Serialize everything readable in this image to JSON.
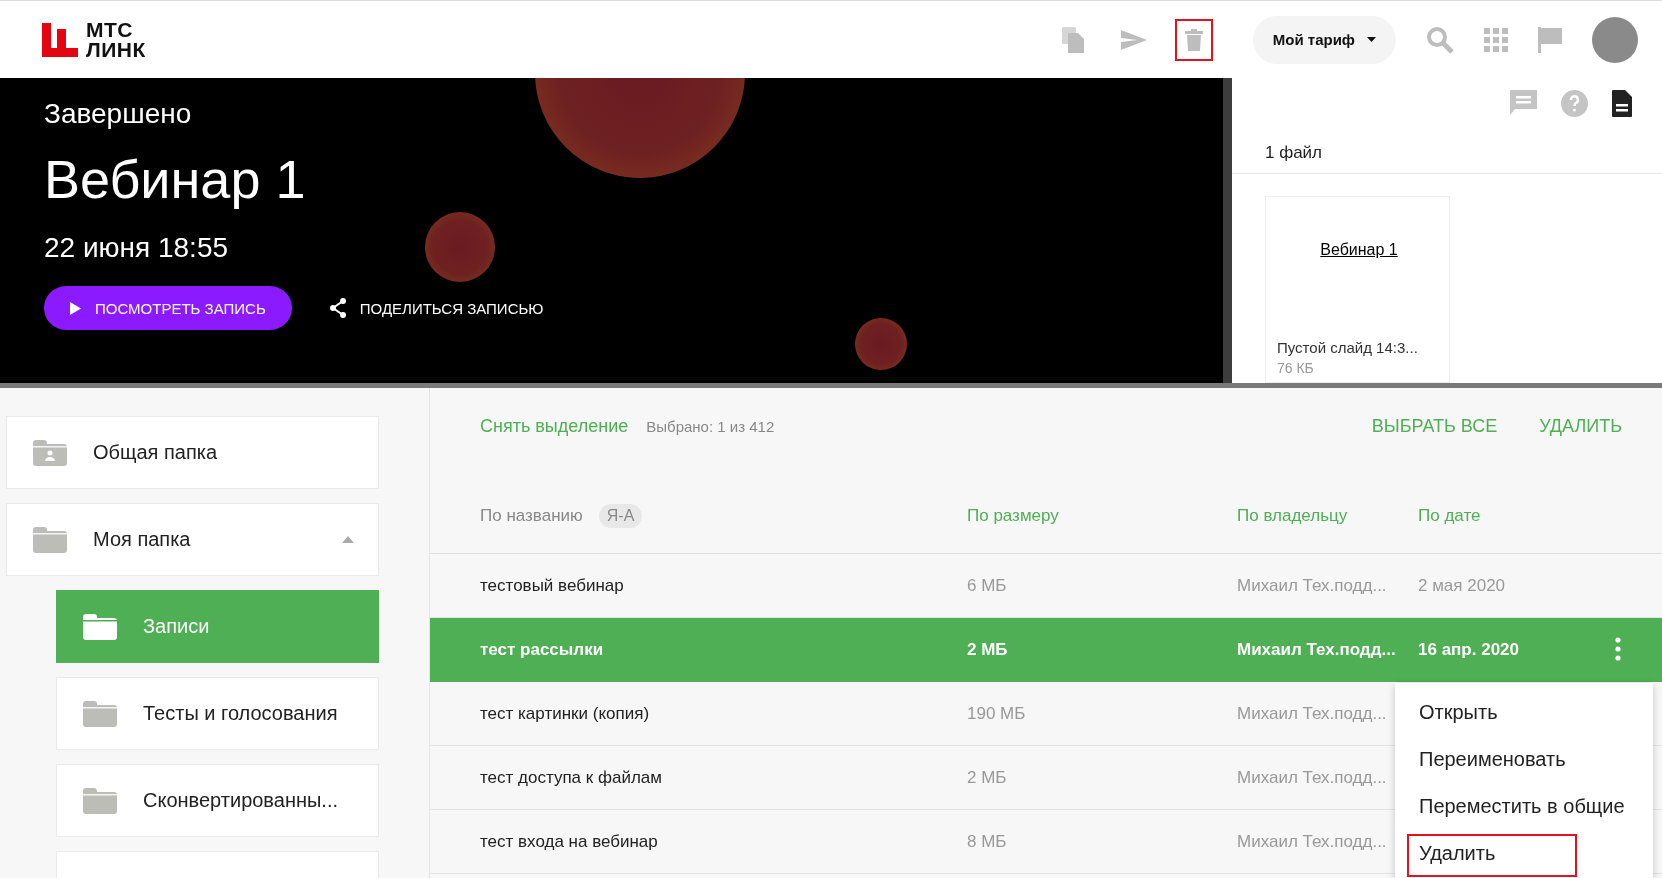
{
  "header": {
    "logo": {
      "line_1": "МТС",
      "line_2": "ЛИНК"
    },
    "toolbar_icons": [
      {
        "kind": "copy",
        "highlighted": false
      },
      {
        "kind": "send",
        "highlighted": false
      },
      {
        "kind": "trash",
        "highlighted": true
      }
    ],
    "plan_button": "Мой тариф"
  },
  "banner": {
    "status": "Завершено",
    "title": "Вебинар 1",
    "date": "22 июня 18:55",
    "watch_button": "ПОСМОТРЕТЬ ЗАПИСЬ",
    "share_button": "ПОДЕЛИТЬСЯ ЗАПИСЬЮ"
  },
  "files_panel": {
    "count": "1 файл",
    "files": [
      {
        "preview_title": "Вебинар 1",
        "name": "Пустой слайд 14:3...",
        "size": "76 КБ"
      }
    ]
  },
  "sidebar": {
    "items": [
      {
        "label": "Общая папка",
        "kind": "shared",
        "selected": false
      },
      {
        "label": "Моя папка",
        "kind": "folder",
        "selected": false,
        "expanded": true,
        "children": [
          {
            "label": "Записи",
            "kind": "folder",
            "selected": true
          },
          {
            "label": "Тесты и голосования",
            "kind": "folder",
            "selected": false
          },
          {
            "label": "Сконвертированны...",
            "kind": "folder",
            "selected": false
          }
        ]
      }
    ]
  },
  "selection_bar": {
    "clear": "Снять выделение",
    "count": "Выбрано: 1 из 412",
    "select_all": "ВЫБРАТЬ ВСЕ",
    "delete": "УДАЛИТЬ"
  },
  "table": {
    "columns": [
      {
        "label": "По названию",
        "active": true,
        "badge": "Я-А"
      },
      {
        "label": "По размеру",
        "active": false
      },
      {
        "label": "По владельцу",
        "active": false
      },
      {
        "label": "По дате",
        "active": false
      }
    ],
    "rows": [
      {
        "name": "тестовый вебинар",
        "size": "6 МБ",
        "owner": "Михаил Тех.подд...",
        "date": "2 мая 2020",
        "selected": false
      },
      {
        "name": "тест рассылки",
        "size": "2 МБ",
        "owner": "Михаил Тех.подд...",
        "date": "16 апр. 2020",
        "selected": true
      },
      {
        "name": "тест картинки (копия)",
        "size": "190 МБ",
        "owner": "Михаил Тех.подд...",
        "selected": false
      },
      {
        "name": "тест доступа к файлам",
        "size": "2 МБ",
        "owner": "Михаил Тех.подд...",
        "selected": false
      },
      {
        "name": "тест входа на вебинар",
        "size": "8 МБ",
        "owner": "Михаил Тех.подд...",
        "selected": false
      }
    ]
  },
  "context_menu": {
    "items": [
      {
        "label": "Открыть",
        "highlighted": false
      },
      {
        "label": "Переименовать",
        "highlighted": false
      },
      {
        "label": "Переместить в общие",
        "highlighted": false
      },
      {
        "label": "Удалить",
        "highlighted": true
      }
    ]
  }
}
